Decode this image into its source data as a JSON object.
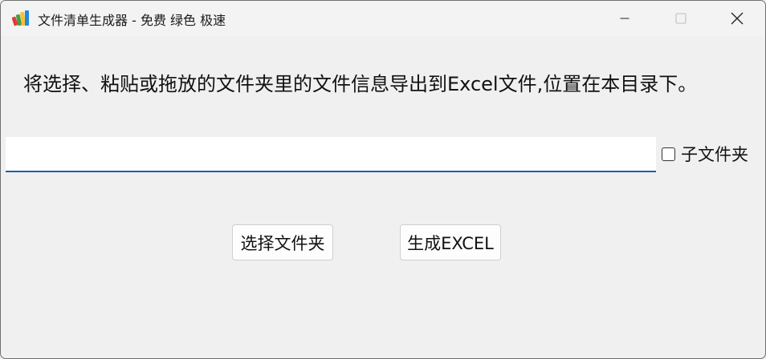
{
  "window": {
    "title": "文件清单生成器 - 免费 绿色 极速",
    "icon": "app-logo-icon",
    "controls": {
      "minimize": "minimize-icon",
      "maximize": "maximize-icon",
      "close": "close-icon"
    }
  },
  "main": {
    "instruction": "将选择、粘贴或拖放的文件夹里的文件信息导出到Excel文件,位置在本目录下。",
    "path_input": {
      "value": "",
      "placeholder": ""
    },
    "subfolder_checkbox": {
      "label": "子文件夹",
      "checked": false
    },
    "buttons": {
      "select_folder": "选择文件夹",
      "generate_excel": "生成EXCEL"
    }
  },
  "colors": {
    "background": "#f0f0f0",
    "input_underline": "#1a5fb4",
    "logo_red": "#e53935",
    "logo_green": "#43a047",
    "logo_yellow": "#fbc02d",
    "logo_blue": "#1e88e5"
  }
}
